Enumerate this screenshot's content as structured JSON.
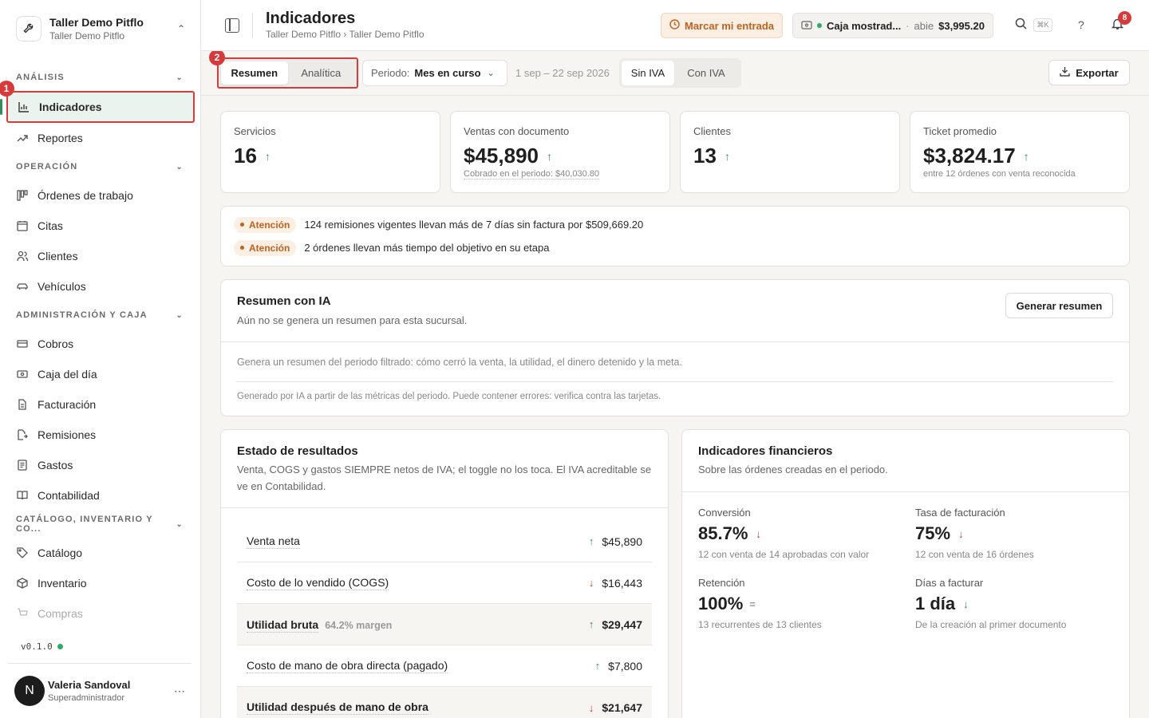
{
  "org": {
    "name": "Taller Demo Pitflo",
    "sub": "Taller Demo Pitflo"
  },
  "sidebar": {
    "sections": [
      {
        "label": "ANÁLISIS",
        "items": [
          {
            "label": "Indicadores",
            "icon": "bar-chart-icon",
            "active": true
          },
          {
            "label": "Reportes",
            "icon": "trend-icon"
          }
        ]
      },
      {
        "label": "OPERACIÓN",
        "items": [
          {
            "label": "Órdenes de trabajo",
            "icon": "kanban-icon"
          },
          {
            "label": "Citas",
            "icon": "calendar-icon"
          },
          {
            "label": "Clientes",
            "icon": "users-icon"
          },
          {
            "label": "Vehículos",
            "icon": "car-icon"
          }
        ]
      },
      {
        "label": "ADMINISTRACIÓN Y CAJA",
        "items": [
          {
            "label": "Cobros",
            "icon": "credit-card-icon"
          },
          {
            "label": "Caja del día",
            "icon": "cash-icon"
          },
          {
            "label": "Facturación",
            "icon": "file-icon"
          },
          {
            "label": "Remisiones",
            "icon": "file-export-icon"
          },
          {
            "label": "Gastos",
            "icon": "receipt-icon"
          },
          {
            "label": "Contabilidad",
            "icon": "book-icon"
          }
        ]
      },
      {
        "label": "CATÁLOGO, INVENTARIO Y CO...",
        "items": [
          {
            "label": "Catálogo",
            "icon": "tag-icon"
          },
          {
            "label": "Inventario",
            "icon": "box-icon"
          },
          {
            "label": "Compras",
            "icon": "cart-icon"
          }
        ]
      }
    ],
    "version": "v0.1.0",
    "user": {
      "initial": "N",
      "name": "Valeria Sandoval",
      "role": "Superadministrador"
    },
    "annotation_1": "1"
  },
  "header": {
    "title": "Indicadores",
    "breadcrumb": "Taller Demo Pitflo › Taller Demo Pitflo",
    "entrada_label": "Marcar mi entrada",
    "caja": {
      "name": "Caja mostrad...",
      "status": "abie",
      "amount": "$3,995.20"
    },
    "kbd": "⌘K",
    "notifications": "8"
  },
  "toolbar": {
    "tabs": [
      "Resumen",
      "Analítica"
    ],
    "annotation_2": "2",
    "periodo_label": "Periodo:",
    "periodo_value": "Mes en curso",
    "range": "1 sep – 22 sep 2026",
    "iva": [
      "Sin IVA",
      "Con IVA"
    ],
    "export_label": "Exportar"
  },
  "kpis": [
    {
      "label": "Servicios",
      "value": "16",
      "sub": ""
    },
    {
      "label": "Ventas con documento",
      "value": "$45,890",
      "sub": "Cobrado en el periodo: $40,030.80"
    },
    {
      "label": "Clientes",
      "value": "13",
      "sub": ""
    },
    {
      "label": "Ticket promedio",
      "value": "$3,824.17",
      "sub": "entre 12 órdenes con venta reconocida"
    }
  ],
  "alerts": [
    {
      "tag": "Atención",
      "text": "124 remisiones vigentes llevan más de 7 días sin factura por $509,669.20"
    },
    {
      "tag": "Atención",
      "text": "2 órdenes llevan más tiempo del objetivo en su etapa"
    }
  ],
  "ai": {
    "title": "Resumen con IA",
    "subtitle": "Aún no se genera un resumen para esta sucursal.",
    "button": "Generar resumen",
    "desc": "Genera un resumen del periodo filtrado: cómo cerró la venta, la utilidad, el dinero detenido y la meta.",
    "disclaimer": "Generado por IA a partir de las métricas del periodo. Puede contener errores: verifica contra las tarjetas."
  },
  "estado": {
    "title": "Estado de resultados",
    "subtitle": "Venta, COGS y gastos SIEMPRE netos de IVA; el toggle no los toca. El IVA acreditable se ve en Contabilidad.",
    "rows": [
      {
        "label": "Venta neta",
        "value": "$45,890",
        "dir": "up"
      },
      {
        "label": "Costo de lo vendido (COGS)",
        "value": "$16,443",
        "dir": "down"
      },
      {
        "label": "Utilidad bruta",
        "margin": "64.2% margen",
        "value": "$29,447",
        "dir": "up"
      },
      {
        "label": "Costo de mano de obra directa (pagado)",
        "value": "$7,800",
        "dir": "up"
      },
      {
        "label": "Utilidad después de mano de obra",
        "value": "$21,647",
        "dir": "down"
      }
    ]
  },
  "financieros": {
    "title": "Indicadores financieros",
    "subtitle": "Sobre las órdenes creadas en el periodo.",
    "items": [
      {
        "label": "Conversión",
        "value": "85.7%",
        "trend": "down",
        "sub": "12 con venta de 14 aprobadas con valor"
      },
      {
        "label": "Tasa de facturación",
        "value": "75%",
        "trend": "down",
        "sub": "12 con venta de 16 órdenes"
      },
      {
        "label": "Retención",
        "value": "100%",
        "trend": "flat",
        "sub": "13 recurrentes de 13 clientes"
      },
      {
        "label": "Días a facturar",
        "value": "1 día",
        "trend": "down",
        "sub": "De la creación al primer documento"
      }
    ]
  }
}
